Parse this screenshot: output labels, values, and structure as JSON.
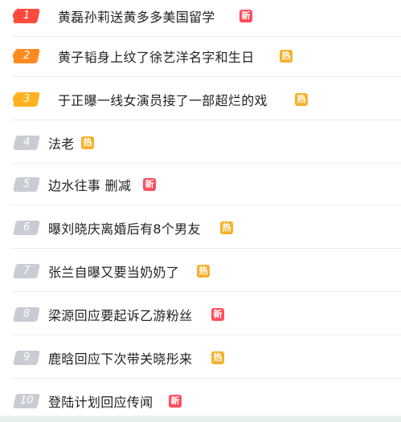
{
  "hot_list": {
    "items": [
      {
        "rank": "1",
        "title": "黄磊孙莉送黄多多美国留学",
        "badge": "新",
        "badge_type": "new",
        "rank_color": "#ff4a3d"
      },
      {
        "rank": "2",
        "title": "黄子韬身上纹了徐艺洋名字和生日",
        "badge": "热",
        "badge_type": "hot",
        "rank_color": "#ff8a1f"
      },
      {
        "rank": "3",
        "title": "于正曝一线女演员接了一部超烂的戏",
        "badge": "热",
        "badge_type": "hot",
        "rank_color": "#ffb21f"
      },
      {
        "rank": "4",
        "title": "法老",
        "badge": "热",
        "badge_type": "hot",
        "rank_color": "#c9ccd3"
      },
      {
        "rank": "5",
        "title": "边水往事 删减",
        "badge": "新",
        "badge_type": "new",
        "rank_color": "#c9ccd3"
      },
      {
        "rank": "6",
        "title": "曝刘晓庆离婚后有8个男友",
        "badge": "热",
        "badge_type": "hot",
        "rank_color": "#c9ccd3"
      },
      {
        "rank": "7",
        "title": "张兰自曝又要当奶奶了",
        "badge": "热",
        "badge_type": "hot",
        "rank_color": "#c9ccd3"
      },
      {
        "rank": "8",
        "title": "梁源回应要起诉乙游粉丝",
        "badge": "新",
        "badge_type": "new",
        "rank_color": "#c9ccd3"
      },
      {
        "rank": "9",
        "title": "鹿晗回应下次带关晓彤来",
        "badge": "热",
        "badge_type": "hot",
        "rank_color": "#c9ccd3"
      },
      {
        "rank": "10",
        "title": "登陆计划回应传闻",
        "badge": "新",
        "badge_type": "new",
        "rank_color": "#c9ccd3"
      }
    ]
  },
  "colors": {
    "new_badge": "#ff4c5b",
    "hot_badge": "#f4b12c",
    "title_text": "#222222"
  }
}
